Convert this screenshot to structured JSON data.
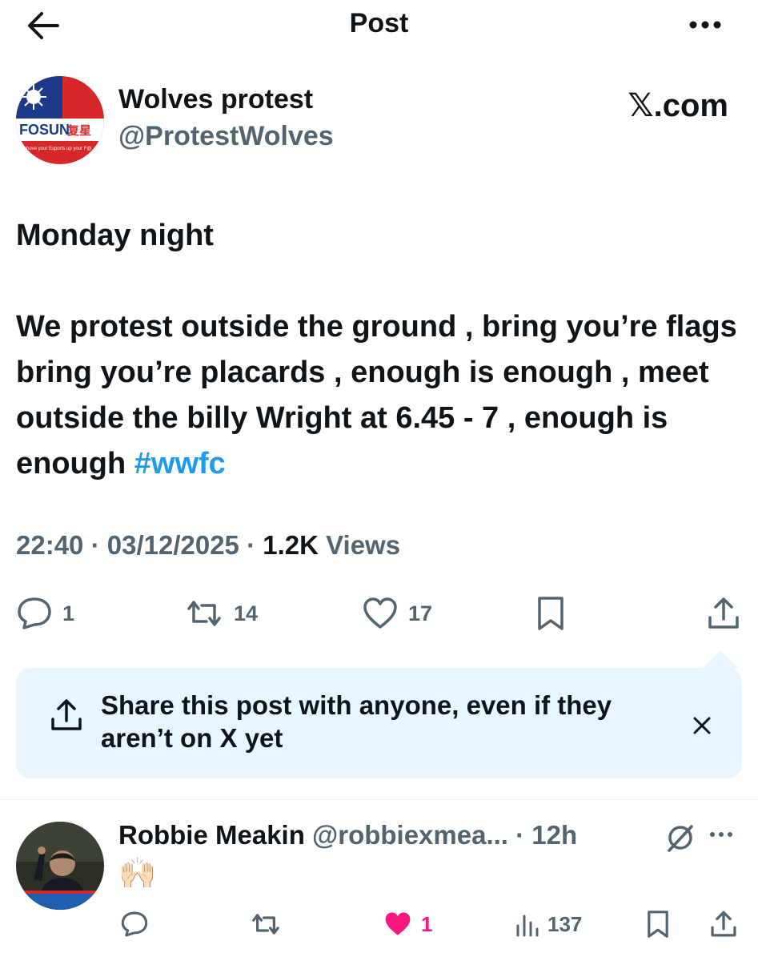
{
  "header": {
    "title": "Post",
    "back_icon": "back-arrow-icon",
    "more_icon": "more-horizontal-icon"
  },
  "author": {
    "name": "Wolves protest",
    "handle": "@ProtestWolves",
    "avatar": {
      "text": "FOSUN",
      "subtext": "shove your Esports up your F@",
      "colors": [
        "#d62828",
        "#1d3a8a",
        "#ffffff"
      ]
    },
    "watermark": "𝕏.com"
  },
  "post": {
    "line1": "Monday night",
    "body": "We protest outside the ground , bring you’re flags bring you’re placards , enough is enough , meet outside the billy Wright at 6.45 - 7 , enough is enough ",
    "hashtag": "#wwfc"
  },
  "meta": {
    "time": "22:40",
    "sep": " · ",
    "date": "03/12/2025",
    "views_count": "1.2K",
    "views_label": "Views"
  },
  "actions": {
    "replies": "1",
    "reposts": "14",
    "likes": "17"
  },
  "share_prompt": {
    "text": "Share this post with anyone, even if they aren’t on X yet"
  },
  "reply": {
    "name": "Robbie Meakin",
    "handle": "@robbiexmea...",
    "sep": " · ",
    "time": "12h",
    "body": "🙌🏻",
    "likes": "1",
    "views": "137"
  },
  "colors": {
    "accent": "#1d9bf0",
    "muted": "#536471",
    "like": "#f91880",
    "share_bg": "#e8f5fd"
  }
}
